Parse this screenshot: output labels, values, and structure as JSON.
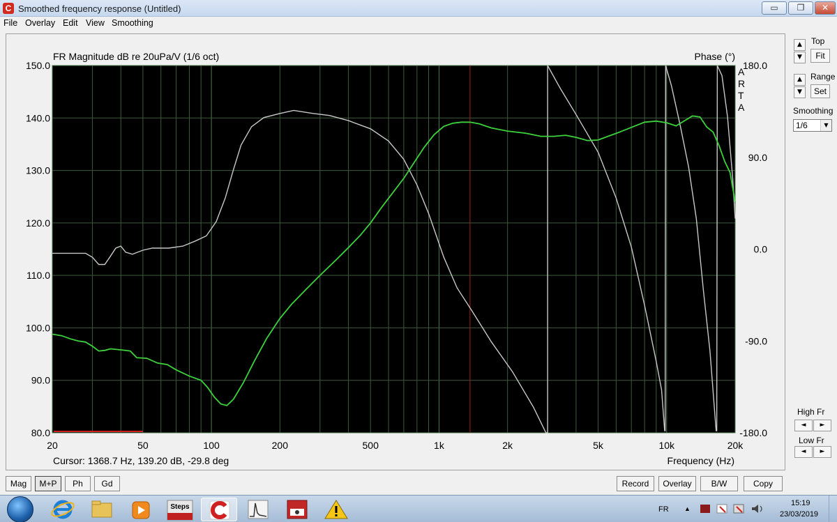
{
  "window": {
    "title": "Smoothed frequency response (Untitled)",
    "minimize": "▭",
    "restore": "❐",
    "close": "✕"
  },
  "menu": [
    "File",
    "Overlay",
    "Edit",
    "View",
    "Smoothing"
  ],
  "plot": {
    "title_left": "FR Magnitude dB re 20uPa/V (1/6 oct)",
    "title_right": "Phase (°)",
    "brand_vertical": [
      "A",
      "R",
      "T",
      "A"
    ],
    "cursor_text": "Cursor: 1368.7 Hz, 139.20 dB, -29.8 deg",
    "xlabel": "Frequency (Hz)",
    "background": "#000000",
    "grid_color": "#3d5a3d",
    "magnitude_color": "#3cd23c",
    "phase_color": "#c8c8c8",
    "cursor_color": "#a02020",
    "marker_color": "#d22020"
  },
  "chart_data": {
    "type": "line",
    "x_scale": "log",
    "xlim": [
      20,
      20000
    ],
    "ylim": [
      80,
      150
    ],
    "y2lim": [
      -180,
      180
    ],
    "x_ticks": [
      "20",
      "50",
      "100",
      "200",
      "500",
      "1k",
      "2k",
      "5k",
      "10k",
      "20k"
    ],
    "y_ticks": [
      "150.0",
      "140.0",
      "130.0",
      "120.0",
      "110.0",
      "100.0",
      "90.0",
      "80.0"
    ],
    "y2_ticks": [
      "180.0",
      "90.0",
      "0.0",
      "-90.0",
      "-180.0"
    ],
    "cursor_x": 1368.7,
    "series": [
      {
        "key": "magnitude",
        "axis": "left",
        "points": [
          [
            20,
            98.8
          ],
          [
            22,
            98.5
          ],
          [
            24,
            97.9
          ],
          [
            26,
            97.5
          ],
          [
            28,
            97.3
          ],
          [
            30,
            96.5
          ],
          [
            32,
            95.6
          ],
          [
            34,
            95.7
          ],
          [
            36,
            96.0
          ],
          [
            40,
            95.8
          ],
          [
            44,
            95.6
          ],
          [
            47,
            94.3
          ],
          [
            52,
            94.2
          ],
          [
            58,
            93.3
          ],
          [
            64,
            93.0
          ],
          [
            70,
            92.0
          ],
          [
            80,
            90.8
          ],
          [
            90,
            90.0
          ],
          [
            96,
            88.7
          ],
          [
            103,
            86.8
          ],
          [
            110,
            85.5
          ],
          [
            117,
            85.2
          ],
          [
            125,
            86.4
          ],
          [
            138,
            89.5
          ],
          [
            155,
            93.8
          ],
          [
            175,
            98.0
          ],
          [
            200,
            101.8
          ],
          [
            225,
            104.5
          ],
          [
            260,
            107.3
          ],
          [
            300,
            110.0
          ],
          [
            350,
            112.8
          ],
          [
            400,
            115.3
          ],
          [
            450,
            117.6
          ],
          [
            500,
            120.0
          ],
          [
            560,
            123.0
          ],
          [
            620,
            125.5
          ],
          [
            700,
            128.5
          ],
          [
            780,
            131.6
          ],
          [
            860,
            134.4
          ],
          [
            950,
            136.8
          ],
          [
            1050,
            138.4
          ],
          [
            1150,
            139.0
          ],
          [
            1250,
            139.2
          ],
          [
            1368.7,
            139.2
          ],
          [
            1500,
            138.9
          ],
          [
            1700,
            138.1
          ],
          [
            2000,
            137.5
          ],
          [
            2400,
            137.1
          ],
          [
            2800,
            136.5
          ],
          [
            3200,
            136.5
          ],
          [
            3600,
            136.7
          ],
          [
            4000,
            136.3
          ],
          [
            4500,
            135.7
          ],
          [
            5000,
            135.8
          ],
          [
            5600,
            136.6
          ],
          [
            6200,
            137.3
          ],
          [
            7000,
            138.2
          ],
          [
            8000,
            139.2
          ],
          [
            9000,
            139.4
          ],
          [
            10000,
            139.1
          ],
          [
            11000,
            138.5
          ],
          [
            12000,
            139.5
          ],
          [
            13000,
            140.4
          ],
          [
            14000,
            140.2
          ],
          [
            15000,
            138.3
          ],
          [
            16000,
            137.3
          ],
          [
            17000,
            134.7
          ],
          [
            18000,
            131.7
          ],
          [
            19000,
            129.6
          ],
          [
            20000,
            124.0
          ]
        ]
      },
      {
        "key": "phase",
        "axis": "right",
        "points": [
          [
            20,
            -4
          ],
          [
            25,
            -4
          ],
          [
            28,
            -4
          ],
          [
            30,
            -8
          ],
          [
            32,
            -15
          ],
          [
            34,
            -15
          ],
          [
            36,
            -7
          ],
          [
            38,
            1
          ],
          [
            40,
            3
          ],
          [
            42,
            -3
          ],
          [
            45,
            -5
          ],
          [
            50,
            -1
          ],
          [
            55,
            1
          ],
          [
            65,
            1
          ],
          [
            75,
            3
          ],
          [
            85,
            8
          ],
          [
            95,
            13
          ],
          [
            105,
            27
          ],
          [
            115,
            50
          ],
          [
            125,
            78
          ],
          [
            135,
            102
          ],
          [
            150,
            120
          ],
          [
            170,
            129
          ],
          [
            200,
            133
          ],
          [
            230,
            136
          ],
          [
            280,
            133
          ],
          [
            330,
            131
          ],
          [
            400,
            126
          ],
          [
            500,
            118
          ],
          [
            600,
            106
          ],
          [
            700,
            88
          ],
          [
            800,
            63
          ],
          [
            900,
            35
          ],
          [
            1050,
            -8
          ],
          [
            1200,
            -38
          ],
          [
            1400,
            -61
          ],
          [
            1700,
            -91
          ],
          [
            2100,
            -120
          ],
          [
            2600,
            -155
          ],
          [
            2950,
            -180
          ],
          [
            3000,
            -180
          ],
          [
            3000,
            180
          ],
          [
            3400,
            158
          ],
          [
            4000,
            132
          ],
          [
            5000,
            95
          ],
          [
            6000,
            50
          ],
          [
            7000,
            2
          ],
          [
            8000,
            -55
          ],
          [
            9000,
            -110
          ],
          [
            9500,
            -138
          ],
          [
            9800,
            -178
          ],
          [
            9850,
            -178
          ],
          [
            9900,
            185
          ],
          [
            10500,
            160
          ],
          [
            11500,
            120
          ],
          [
            12500,
            80
          ],
          [
            13500,
            30
          ],
          [
            14500,
            -40
          ],
          [
            15500,
            -100
          ],
          [
            16500,
            -178
          ],
          [
            16600,
            -178
          ],
          [
            16700,
            180
          ],
          [
            17500,
            170
          ],
          [
            18500,
            130
          ],
          [
            19500,
            70
          ],
          [
            20000,
            30
          ]
        ]
      }
    ]
  },
  "right_panel": {
    "top_label": "Top",
    "fit_label": "Fit",
    "range_label": "Range",
    "set_label": "Set",
    "smoothing_label": "Smoothing",
    "smoothing_value": "1/6",
    "high_fr_label": "High Fr",
    "low_fr_label": "Low Fr",
    "up_glyph": "▲",
    "down_glyph": "▼",
    "left_glyph": "◄",
    "right_glyph": "►"
  },
  "bottom_buttons_left": [
    "Mag",
    "M+P",
    "Ph",
    "Gd"
  ],
  "bottom_active": "M+P",
  "bottom_buttons_right": [
    "Record",
    "Overlay",
    "B/W",
    "Copy"
  ],
  "taskbar": {
    "steps_label": "Steps",
    "lang": "FR",
    "time": "15:19",
    "date": "23/03/2019",
    "up_arrow": "▲"
  }
}
